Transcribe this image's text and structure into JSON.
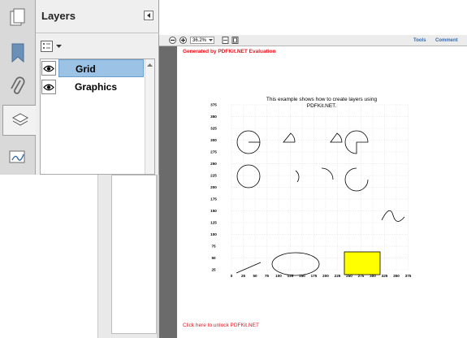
{
  "panel": {
    "title": "Layers",
    "layers": [
      {
        "name": "Grid",
        "selected": true
      },
      {
        "name": "Graphics",
        "selected": false
      }
    ]
  },
  "rail": {
    "icons": [
      "pages-icon",
      "bookmark-icon",
      "attachment-icon",
      "layers-icon",
      "signature-icon"
    ],
    "active": "layers-icon"
  },
  "toolbar": {
    "zoom": "36.2%",
    "tools_label": "Tools",
    "comment_label": "Comment"
  },
  "document": {
    "eval_banner": "Generated by PDFKit.NET Evaluation",
    "unlock_link": "Click here to unlock PDFKit.NET",
    "description_line1": "This example shows how to create layers using",
    "description_line2": "PDFKit.NET.",
    "x_ticks": [
      "0",
      "25",
      "50",
      "75",
      "100",
      "125",
      "150",
      "175",
      "200",
      "225",
      "250",
      "275",
      "300",
      "325",
      "350",
      "375"
    ],
    "y_ticks": [
      "375",
      "350",
      "325",
      "300",
      "275",
      "250",
      "225",
      "200",
      "175",
      "150",
      "125",
      "100",
      "75",
      "50",
      "25"
    ]
  },
  "colors": {
    "eval_red": "#e8141c",
    "rect_fill": "#ffff00",
    "selected_row": "#9cc3e5",
    "accent_link": "#3a6aa8"
  }
}
